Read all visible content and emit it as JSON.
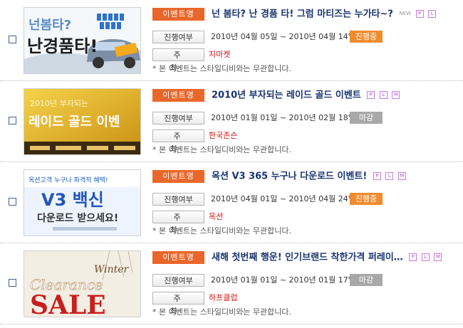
{
  "labels": {
    "tag": "이벤트명",
    "progress_button": "진행여부",
    "host_button": "주 최",
    "note": "* 본 이벤트는 스타일디비와는 무관합니다."
  },
  "events": [
    {
      "title": "넌 봄타? 난 경품 타! 그럼 마티즈는 누가타~?",
      "badges": [
        "NEW",
        "P",
        "L"
      ],
      "period": "2010년 04월 05일 ~ 2010년 04월 14일",
      "status": "진행중",
      "sponsor": "지마켓",
      "thumb": {
        "line1": "넌봄타?",
        "line2": "난경품타!"
      }
    },
    {
      "title": "2010년 부자되는 레이드 골드 이벤트",
      "badges": [
        "P",
        "L",
        "M"
      ],
      "period": "2010년 01월 01일 ~ 2010년 02월 18일",
      "status": "마감",
      "sponsor": "한국존슨",
      "thumb": {
        "line1": "2010년 부자되는",
        "line2": "레이드 골드 이벤"
      }
    },
    {
      "title": "옥션 V3 365 누구나 다운로드 이벤트!",
      "badges": [
        "P",
        "L",
        "M"
      ],
      "period": "2010년 04월 01일 ~ 2010년 04월 24일",
      "status": "진행중",
      "sponsor": "옥션",
      "thumb": {
        "line1": "옥션고객 누구나 파격적 혜택!",
        "line2": "V3 백신",
        "line3": "다운로드 받으세요!"
      }
    },
    {
      "title": "새해 첫번째 행운! 인기브랜드 착한가격 퍼레이…",
      "badges": [
        "P",
        "L",
        "M"
      ],
      "period": "2010년 01월 01일 ~ 2010년 01월 17일",
      "status": "마감",
      "sponsor": "하프클럽",
      "thumb": {
        "line1": "Winter",
        "line2": "Clearance",
        "line3": "SALE"
      }
    }
  ],
  "colors": {
    "tag": "#e9672a",
    "title": "#1a3470",
    "status_active": "#f08c2e",
    "status_closed": "#a8a8a8",
    "sponsor": "#cc1616"
  }
}
